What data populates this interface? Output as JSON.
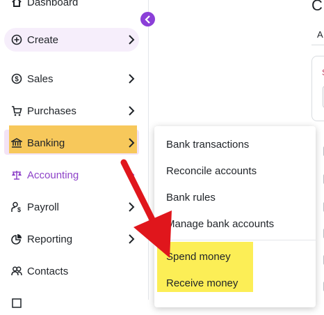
{
  "sidebar": {
    "top_partial_label": "Dashboard",
    "items": [
      {
        "label": "Create",
        "icon": "plus-circle-icon"
      },
      {
        "label": "Sales",
        "icon": "dollar-circle-icon"
      },
      {
        "label": "Purchases",
        "icon": "cart-icon"
      },
      {
        "label": "Banking",
        "icon": "bank-icon"
      },
      {
        "label": "Accounting",
        "icon": "scales-icon"
      },
      {
        "label": "Payroll",
        "icon": "person-dollar-icon"
      },
      {
        "label": "Reporting",
        "icon": "pie-chart-icon"
      },
      {
        "label": "Contacts",
        "icon": "people-icon"
      }
    ],
    "collapse_icon": "chevron-left-icon"
  },
  "banking_menu": {
    "items": [
      "Bank transactions",
      "Reconcile accounts",
      "Bank rules",
      "Manage bank accounts"
    ],
    "highlighted_items": [
      "Spend money",
      "Receive money"
    ]
  },
  "right_panel": {
    "title_partial": "C",
    "tab_partial": "A",
    "field_partial": "S"
  },
  "colors": {
    "accent_purple": "#8b3fd8",
    "highlight_orange": "#f7c85b",
    "highlight_yellow": "#fcee56",
    "arrow_red": "#e0161c"
  }
}
